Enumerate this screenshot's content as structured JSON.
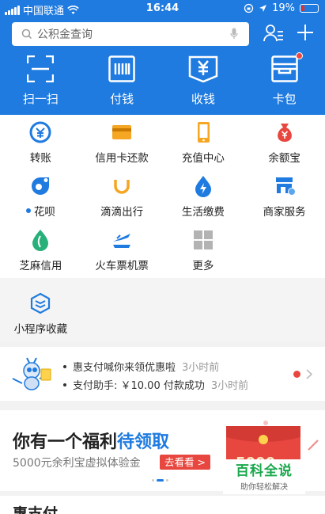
{
  "status_bar": {
    "carrier": "中国联通",
    "time": "16:44",
    "battery": "19%"
  },
  "search": {
    "placeholder": "公积金查询"
  },
  "top_tools": [
    {
      "label": "扫一扫",
      "icon": "scan-icon"
    },
    {
      "label": "付钱",
      "icon": "barcode-icon"
    },
    {
      "label": "收钱",
      "icon": "yuan-receive-icon"
    },
    {
      "label": "卡包",
      "icon": "card-wallet-icon"
    }
  ],
  "grid": [
    {
      "label": "转账",
      "icon": "transfer-icon"
    },
    {
      "label": "信用卡还款",
      "icon": "credit-card-icon"
    },
    {
      "label": "充值中心",
      "icon": "phone-recharge-icon"
    },
    {
      "label": "余额宝",
      "icon": "money-bag-icon"
    },
    {
      "label": "花呗",
      "icon": "huabei-icon"
    },
    {
      "label": "滴滴出行",
      "icon": "didi-icon"
    },
    {
      "label": "生活缴费",
      "icon": "utility-bolt-icon"
    },
    {
      "label": "商家服务",
      "icon": "merchant-service-icon"
    },
    {
      "label": "芝麻信用",
      "icon": "sesame-credit-icon"
    },
    {
      "label": "火车票机票",
      "icon": "train-plane-icon"
    },
    {
      "label": "更多",
      "icon": "more-grid-icon"
    }
  ],
  "mini_program": {
    "label": "小程序收藏",
    "icon": "mini-program-icon"
  },
  "news": [
    {
      "text": "惠支付喊你来领优惠啦",
      "time": "3小时前"
    },
    {
      "text": "支付助手: ￥10.00 付款成功",
      "time": "3小时前"
    }
  ],
  "promo": {
    "title_prefix": "你有一个福利",
    "title_highlight": "待领取",
    "subtitle": "5000元余利宝虚拟体验金",
    "button": "去看看 >",
    "card_amount": "5000"
  },
  "watermark": {
    "title": "百科全说",
    "subtitle": "助你轻松解决"
  },
  "next_section": {
    "title": "惠支付"
  },
  "colors": {
    "brand_blue": "#1f7be0",
    "accent_red": "#e8473f",
    "orange": "#f5a623"
  }
}
